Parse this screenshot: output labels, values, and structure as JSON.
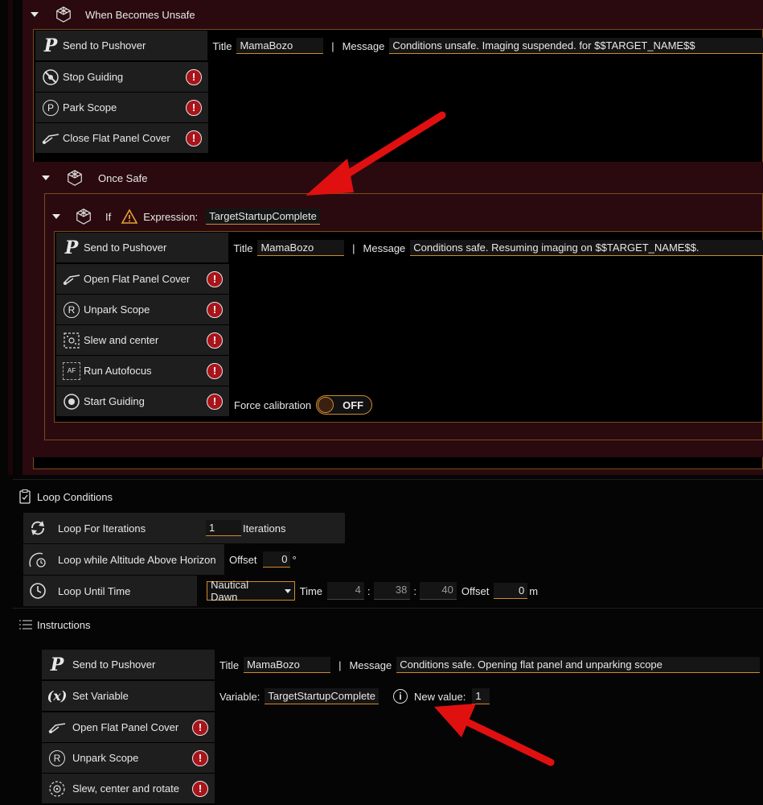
{
  "when_unsafe": {
    "label": "When Becomes Unsafe",
    "pushover": {
      "name": "Send to Pushover",
      "title_label": "Title",
      "title_value": "MamaBozo",
      "sep": "|",
      "message_label": "Message",
      "message_value": "Conditions unsafe. Imaging suspended. for $$TARGET_NAME$$"
    },
    "items": [
      {
        "name": "Stop Guiding",
        "warn": "!"
      },
      {
        "name": "Park Scope",
        "warn": "!"
      },
      {
        "name": "Close Flat Panel Cover",
        "warn": "!"
      }
    ]
  },
  "once_safe": {
    "label": "Once Safe",
    "if_block": {
      "label": "If",
      "expression_label": "Expression:",
      "expression_value": "TargetStartupComplete",
      "pushover": {
        "name": "Send to Pushover",
        "title_label": "Title",
        "title_value": "MamaBozo",
        "sep": "|",
        "message_label": "Message",
        "message_value": "Conditions safe. Resuming imaging on $$TARGET_NAME$$."
      },
      "items": [
        {
          "name": "Open Flat Panel Cover",
          "warn": "!"
        },
        {
          "name": "Unpark Scope",
          "warn": "!"
        },
        {
          "name": "Slew and center",
          "warn": "!"
        },
        {
          "name": "Run Autofocus",
          "warn": "!"
        },
        {
          "name": "Start Guiding",
          "warn": "!"
        }
      ],
      "autofocus_icon_text": "AF",
      "force_calibration_label": "Force calibration",
      "toggle_text": "OFF"
    }
  },
  "loop_conditions": {
    "label": "Loop Conditions",
    "iterations": {
      "name": "Loop For Iterations",
      "value": "1",
      "suffix": "Iterations"
    },
    "altitude": {
      "name": "Loop while Altitude Above Horizon",
      "offset_label": "Offset",
      "offset_value": "0",
      "unit": "°"
    },
    "until_time": {
      "name": "Loop Until Time",
      "dropdown_value": "Nautical Dawn",
      "time_label": "Time",
      "hh": "4",
      "mm": "38",
      "ss": "40",
      "colon": ":",
      "offset_label": "Offset",
      "offset_value": "0",
      "unit": "m"
    }
  },
  "instructions": {
    "label": "Instructions",
    "pushover": {
      "name": "Send to Pushover",
      "title_label": "Title",
      "title_value": "MamaBozo",
      "sep": "|",
      "message_label": "Message",
      "message_value": "Conditions safe. Opening flat panel and unparking scope"
    },
    "set_variable": {
      "name": "Set Variable",
      "icon_text": "(x)",
      "variable_label": "Variable:",
      "variable_value": "TargetStartupComplete",
      "info_icon": "i",
      "new_value_label": "New value:",
      "new_value": "1"
    },
    "items": [
      {
        "name": "Open Flat Panel Cover",
        "warn": "!"
      },
      {
        "name": "Unpark Scope",
        "warn": "!"
      },
      {
        "name": "Slew, center and rotate",
        "warn": "!"
      }
    ]
  },
  "pushover_icon_text": "P",
  "park_icon_text": "P",
  "unpark_icon_text": "R",
  "colors": {
    "accent": "#d08a2a",
    "warning": "#a8141a",
    "panel_bg": "#2a0a0f",
    "arrow": "#e01010"
  }
}
